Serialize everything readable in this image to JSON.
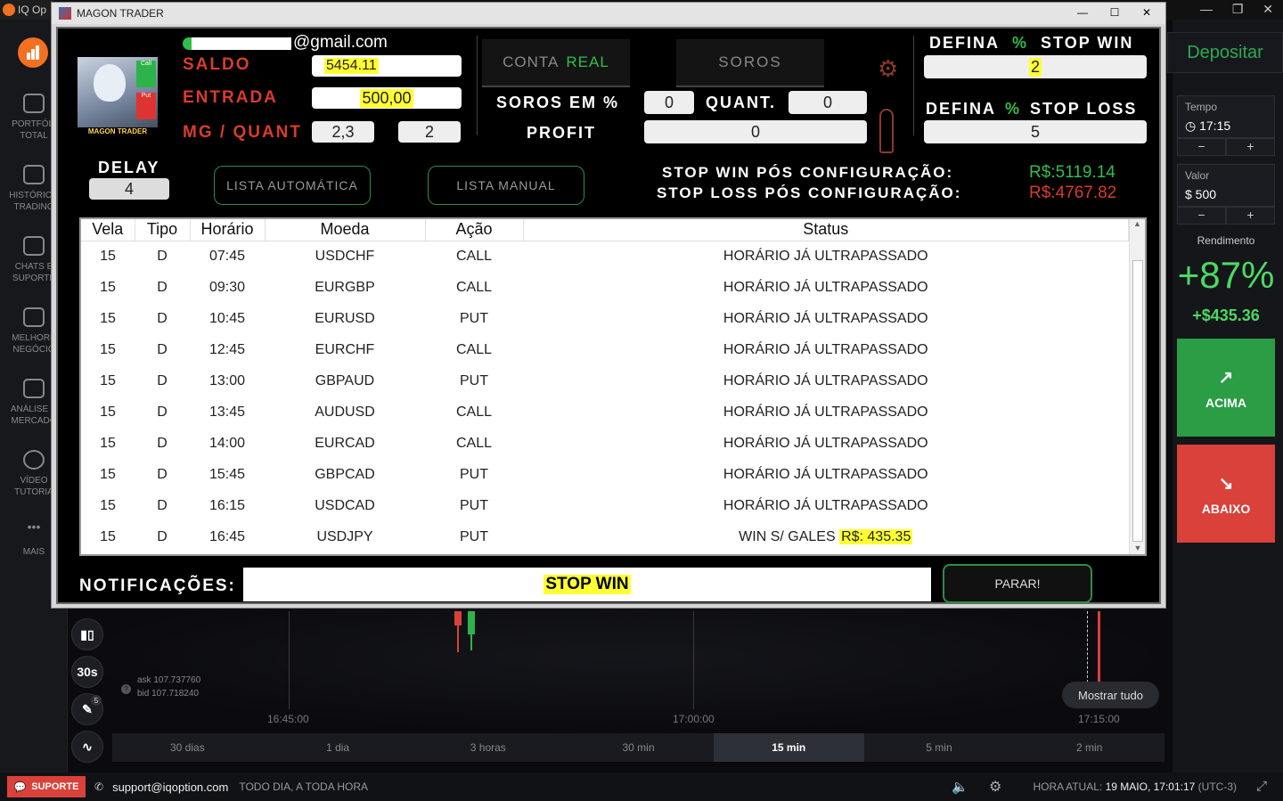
{
  "browser": {
    "tab_title": "IQ Op"
  },
  "iq_sidebar": [
    {
      "icon": "briefcase-icon",
      "label": "PORTFÓLI\nTOTAL"
    },
    {
      "icon": "history-icon",
      "label": "HISTÓRICO\nTRADING"
    },
    {
      "icon": "chat-icon",
      "label": "CHATS E\nSUPORTE"
    },
    {
      "icon": "leaderboard-icon",
      "label": "MELHORE\nNEGÓCIO"
    },
    {
      "icon": "news-icon",
      "label": "ANÁLISE D\nMERCADO"
    },
    {
      "icon": "play-icon",
      "label": "VÍDEO\nTUTORIA"
    },
    {
      "icon": "more-icon",
      "label": "MAIS"
    }
  ],
  "iq_right": {
    "deposit_label": "Depositar",
    "tempo_label": "Tempo",
    "tempo_value": "17:15",
    "valor_label": "Valor",
    "valor_value": "$  500",
    "minus": "−",
    "plus": "+",
    "rendimento_label": "Rendimento",
    "rendimento_pct": "+87%",
    "rendimento_value": "+$435.36",
    "acima_label": "ACIMA",
    "abaixo_label": "ABAIXO"
  },
  "chart": {
    "ask": "ask 107.737760",
    "bid": "bid 107.718240",
    "time_labels": [
      "16:45:00",
      "17:00:00",
      "17:15:00"
    ],
    "interval_badge": "30s",
    "tool_badge": "5",
    "mostrar_tudo": "Mostrar tudo",
    "timeframes": [
      "30 dias",
      "1 dia",
      "3 horas",
      "30 min",
      "15 min",
      "5 min",
      "2 min"
    ],
    "active_timeframe": "15 min"
  },
  "status_bar": {
    "support_label": "SUPORTE",
    "support_email": "support@iqoption.com",
    "support_hours": "TODO DIA, A TODA HORA",
    "hora_label": "HORA ATUAL:",
    "hora_value": "19 MAIO, 17:01:17",
    "timezone": "(UTC-3)"
  },
  "window": {
    "title": "MAGON TRADER",
    "controls": [
      "—",
      "☐",
      "✕"
    ]
  },
  "bot": {
    "account_email": "@gmail.com",
    "avatar_name": "MAGON TRADER",
    "avatar_call": "Call",
    "avatar_put": "Put",
    "saldo_label": "SALDO",
    "saldo_value": "5454.11",
    "entrada_label": "ENTRADA",
    "entrada_value": "500,00",
    "mg_label": "MG / QUANT",
    "mg_value": "2,3",
    "quant_value": "2",
    "delay_label": "DELAY",
    "delay_value": "4",
    "conta_prefix": "CONTA",
    "conta_real": "REAL",
    "soros_tab": "SOROS",
    "soros_pct_label": "SOROS EM %",
    "soros_pct_value": "0",
    "quant_label": "QUANT.",
    "quant2_value": "0",
    "profit_label": "PROFIT",
    "profit_value": "0",
    "stop_win_label_a": "DEFINA",
    "stop_win_label_pct": "%",
    "stop_win_label_b": "STOP WIN",
    "stop_win_value": "2",
    "stop_loss_label_b": "STOP LOSS",
    "stop_loss_value": "5",
    "lista_auto": "LISTA AUTOMÁTICA",
    "lista_manual": "LISTA MANUAL",
    "stop_win_pos_label": "STOP WIN PÓS CONFIGURAÇÃO:",
    "stop_win_pos_value": "R$:5119.14",
    "stop_loss_pos_label": "STOP LOSS PÓS CONFIGURAÇÃO:",
    "stop_loss_pos_value": "R$:4767.82",
    "colors": {
      "green": "#2fbf4a",
      "red": "#d83c2c",
      "highlight": "#ffff33"
    },
    "table": {
      "headers": [
        "Vela",
        "Tipo",
        "Horário",
        "Moeda",
        "Ação",
        "Status"
      ],
      "rows": [
        [
          "15",
          "D",
          "07:45",
          "USDCHF",
          "CALL",
          "HORÁRIO JÁ ULTRAPASSADO"
        ],
        [
          "15",
          "D",
          "09:30",
          "EURGBP",
          "CALL",
          "HORÁRIO JÁ ULTRAPASSADO"
        ],
        [
          "15",
          "D",
          "10:45",
          "EURUSD",
          "PUT",
          "HORÁRIO JÁ ULTRAPASSADO"
        ],
        [
          "15",
          "D",
          "12:45",
          "EURCHF",
          "CALL",
          "HORÁRIO JÁ ULTRAPASSADO"
        ],
        [
          "15",
          "D",
          "13:00",
          "GBPAUD",
          "PUT",
          "HORÁRIO JÁ ULTRAPASSADO"
        ],
        [
          "15",
          "D",
          "13:45",
          "AUDUSD",
          "CALL",
          "HORÁRIO JÁ ULTRAPASSADO"
        ],
        [
          "15",
          "D",
          "14:00",
          "EURCAD",
          "CALL",
          "HORÁRIO JÁ ULTRAPASSADO"
        ],
        [
          "15",
          "D",
          "15:45",
          "GBPCAD",
          "PUT",
          "HORÁRIO JÁ ULTRAPASSADO"
        ],
        [
          "15",
          "D",
          "16:15",
          "USDCAD",
          "PUT",
          "HORÁRIO JÁ ULTRAPASSADO"
        ],
        [
          "15",
          "D",
          "16:45",
          "USDJPY",
          "PUT",
          "WIN S/ GALES |R$: 435.35"
        ]
      ]
    },
    "notif_label": "NOTIFICAÇÕES:",
    "notif_value": "STOP WIN",
    "parar_label": "PARAR!"
  }
}
